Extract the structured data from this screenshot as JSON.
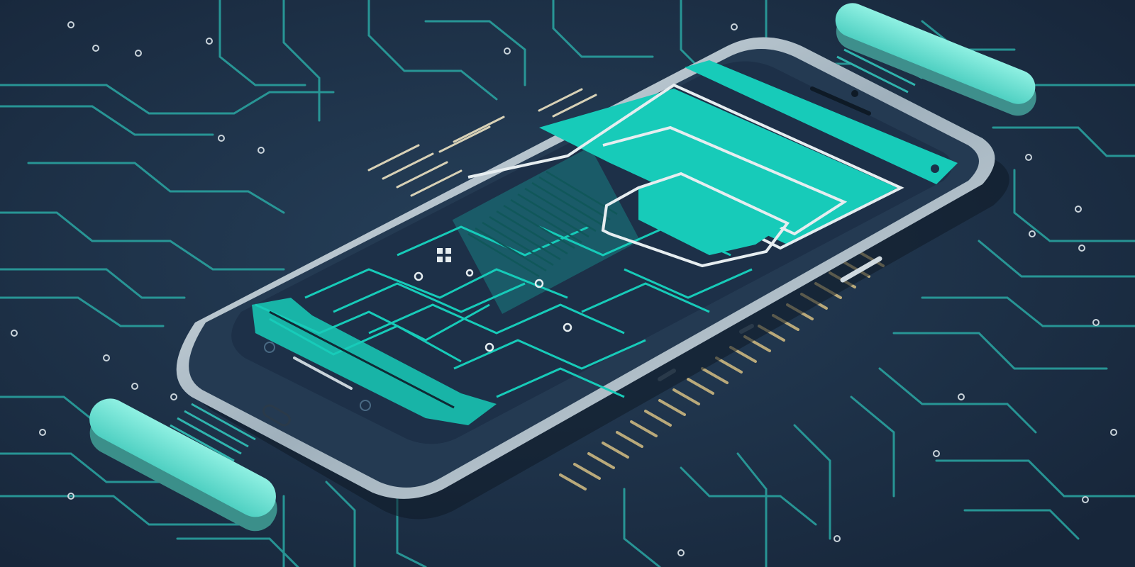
{
  "scene": {
    "subject": "smartphone-on-circuit-board",
    "palette": {
      "background": "#1b2a3b",
      "background_light": "#24394f",
      "trace": "#2fb3ad",
      "trace_dim": "#1f7f86",
      "accent": "#17cbb9",
      "accent_light": "#7ee8da",
      "phone_frame": "#c9d3da",
      "phone_body": "#2a3f57",
      "screen": "#1e3149",
      "outline": "#e6edf0",
      "pins": "#b9a97a"
    }
  }
}
